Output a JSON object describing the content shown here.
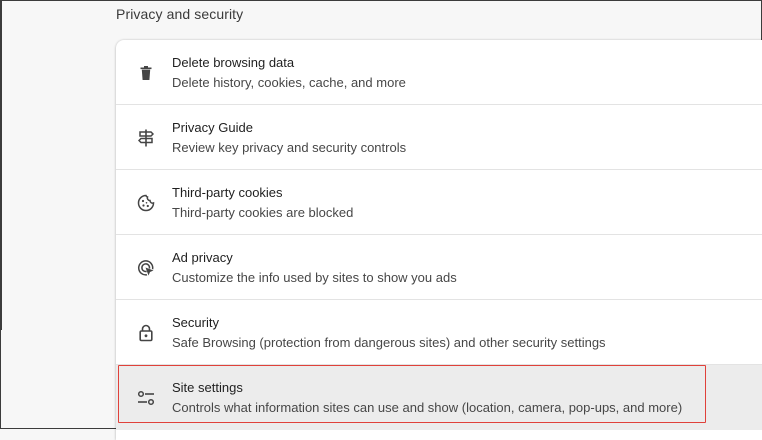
{
  "section": {
    "title": "Privacy and security"
  },
  "rows": [
    {
      "title": "Delete browsing data",
      "subtitle": "Delete history, cookies, cache, and more",
      "icon": "trash-icon"
    },
    {
      "title": "Privacy Guide",
      "subtitle": "Review key privacy and security controls",
      "icon": "signpost-icon"
    },
    {
      "title": "Third-party cookies",
      "subtitle": "Third-party cookies are blocked",
      "icon": "cookie-icon"
    },
    {
      "title": "Ad privacy",
      "subtitle": "Customize the info used by sites to show you ads",
      "icon": "ad-privacy-icon"
    },
    {
      "title": "Security",
      "subtitle": "Safe Browsing (protection from dangerous sites) and other security settings",
      "icon": "lock-icon"
    },
    {
      "title": "Site settings",
      "subtitle": "Controls what information sites can use and show (location, camera, pop-ups, and more)",
      "icon": "tune-icon"
    }
  ],
  "colors": {
    "highlight_border": "#e0413a",
    "highlight_row_bg": "#ececec",
    "card_bg": "#ffffff",
    "page_bg": "#f7f7f7"
  }
}
